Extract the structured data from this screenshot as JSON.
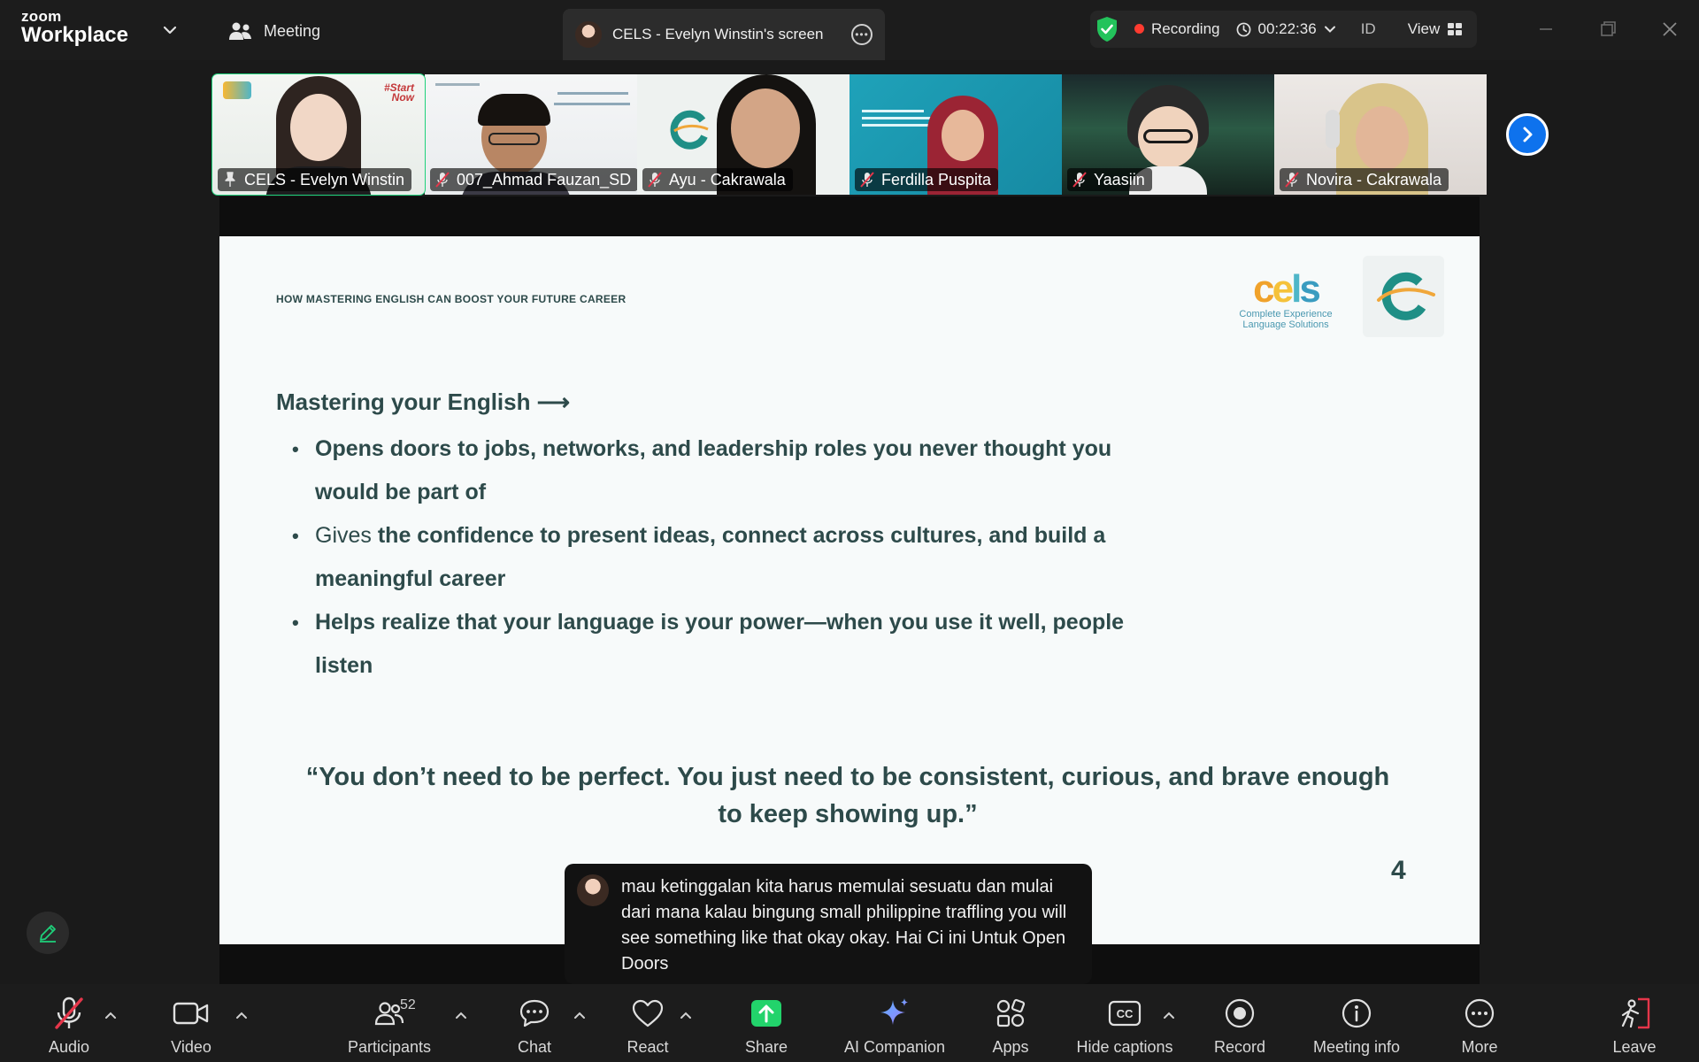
{
  "titlebar": {
    "brand_line1": "zoom",
    "brand_line2": "Workplace",
    "meeting_label": "Meeting",
    "share_tab_title": "CELS - Evelyn Winstin's screen",
    "recording_label": "Recording",
    "elapsed_time": "00:22:36",
    "language": "ID",
    "view_label": "View"
  },
  "gallery": {
    "participants": [
      {
        "name": "CELS - Evelyn Winstin",
        "pinned": true,
        "muted": false
      },
      {
        "name": "007_Ahmad Fauzan_SD",
        "muted": true
      },
      {
        "name": "Ayu - Cakrawala",
        "muted": true
      },
      {
        "name": "Ferdilla Puspita",
        "muted": true
      },
      {
        "name": "Yaasiin",
        "muted": true
      },
      {
        "name": "Novira - Cakrawala",
        "muted": true
      }
    ],
    "tile0_hashtag_line1": "#Start",
    "tile0_hashtag_line2": "Now"
  },
  "slide": {
    "header": "HOW MASTERING ENGLISH CAN BOOST YOUR FUTURE CAREER",
    "logo_word": "cels",
    "logo_sub_line1": "Complete Experience",
    "logo_sub_line2": "Language Solutions",
    "lead": "Mastering your English ⟶",
    "bullets": [
      {
        "prefix": "",
        "text": "Opens doors to jobs, networks, and leadership roles you never thought you would be part of"
      },
      {
        "prefix": "Gives ",
        "text": "the confidence to present ideas, connect across cultures, and build a meaningful career"
      },
      {
        "prefix": "",
        "text": "Helps realize that your language is your power—when you use it well, people listen"
      }
    ],
    "quote": "“You don’t need to be perfect. You just need to be consistent, curious, and brave enough to keep showing up.”",
    "page_number": "4"
  },
  "caption": {
    "text": "mau ketinggalan kita harus memulai sesuatu dan mulai dari mana kalau bingung small philippine traffling you will see something like that okay okay. Hai Ci ini Untuk Open Doors"
  },
  "toolbar": {
    "audio": "Audio",
    "video": "Video",
    "participants": "Participants",
    "participants_count": "52",
    "chat": "Chat",
    "react": "React",
    "share": "Share",
    "ai_companion": "AI Companion",
    "apps": "Apps",
    "hide_captions": "Hide captions",
    "record": "Record",
    "meeting_info": "Meeting info",
    "more": "More",
    "leave": "Leave"
  },
  "colors": {
    "accent_green": "#1ed17a",
    "recording_red": "#ff3b30",
    "share_green": "#22d36b",
    "primary_blue": "#0e72ed",
    "slide_text": "#2d4a4a",
    "leave_red": "#e5364a"
  },
  "icons": [
    "zoom-logo",
    "chevron-down-icon",
    "people-icon",
    "more-icon",
    "shield-check-icon",
    "clock-icon",
    "grid-icon",
    "minimize-icon",
    "restore-icon",
    "close-icon",
    "mic-muted-icon",
    "pin-icon",
    "chevron-right-icon",
    "pencil-icon",
    "video-icon",
    "chat-icon",
    "heart-icon",
    "share-arrow-icon",
    "sparkle-icon",
    "apps-icon",
    "cc-icon",
    "record-icon",
    "info-icon",
    "leave-icon"
  ]
}
